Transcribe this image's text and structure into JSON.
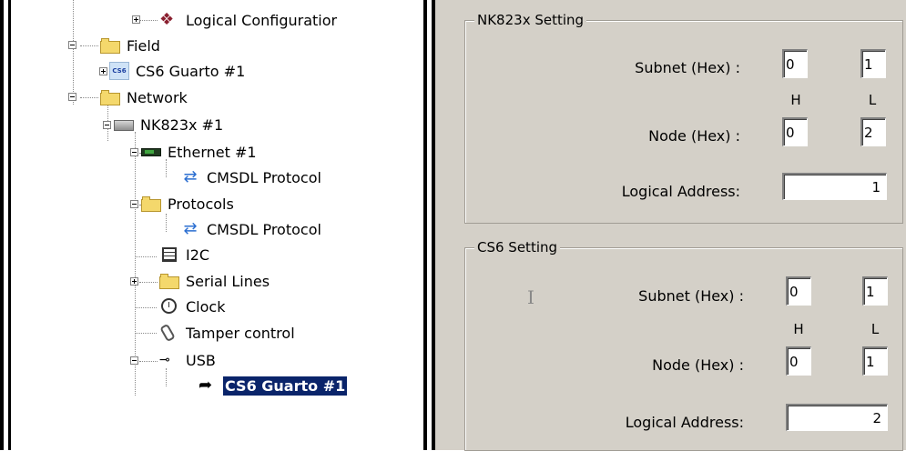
{
  "tree": {
    "nodes": [
      {
        "label": "Logical Configuratior",
        "icon": "logical-config-icon"
      },
      {
        "label": "Field",
        "icon": "folder-icon"
      },
      {
        "label": "CS6 Guarto #1",
        "icon": "cs6-device-icon",
        "icon_text": "CS6"
      },
      {
        "label": "Network",
        "icon": "folder-icon"
      },
      {
        "label": "NK823x #1",
        "icon": "network-device-icon"
      },
      {
        "label": "Ethernet #1",
        "icon": "ethernet-icon"
      },
      {
        "label": "CMSDL Protocol",
        "icon": "protocol-icon"
      },
      {
        "label": "Protocols",
        "icon": "folder-icon"
      },
      {
        "label": "CMSDL Protocol",
        "icon": "protocol-icon"
      },
      {
        "label": "I2C",
        "icon": "chip-icon"
      },
      {
        "label": "Serial Lines",
        "icon": "folder-icon"
      },
      {
        "label": "Clock",
        "icon": "clock-icon"
      },
      {
        "label": "Tamper control",
        "icon": "tamper-icon"
      },
      {
        "label": "USB",
        "icon": "usb-icon"
      },
      {
        "label": "CS6 Guarto #1",
        "icon": "link-icon",
        "selected": true
      }
    ]
  },
  "nk823x": {
    "title": "NK823x Setting",
    "subnet_label": "Subnet (Hex) :",
    "subnet_h": "0",
    "subnet_l": "1",
    "h_label": "H",
    "l_label": "L",
    "node_label": "Node (Hex) :",
    "node_h": "0",
    "node_l": "2",
    "logical_label": "Logical Address:",
    "logical_value": "1"
  },
  "cs6": {
    "title": "CS6 Setting",
    "subnet_label": "Subnet (Hex) :",
    "subnet_h": "0",
    "subnet_l": "1",
    "h_label": "H",
    "l_label": "L",
    "node_label": "Node (Hex) :",
    "node_h": "0",
    "node_l": "1",
    "logical_label": "Logical Address:",
    "logical_value": "2"
  }
}
